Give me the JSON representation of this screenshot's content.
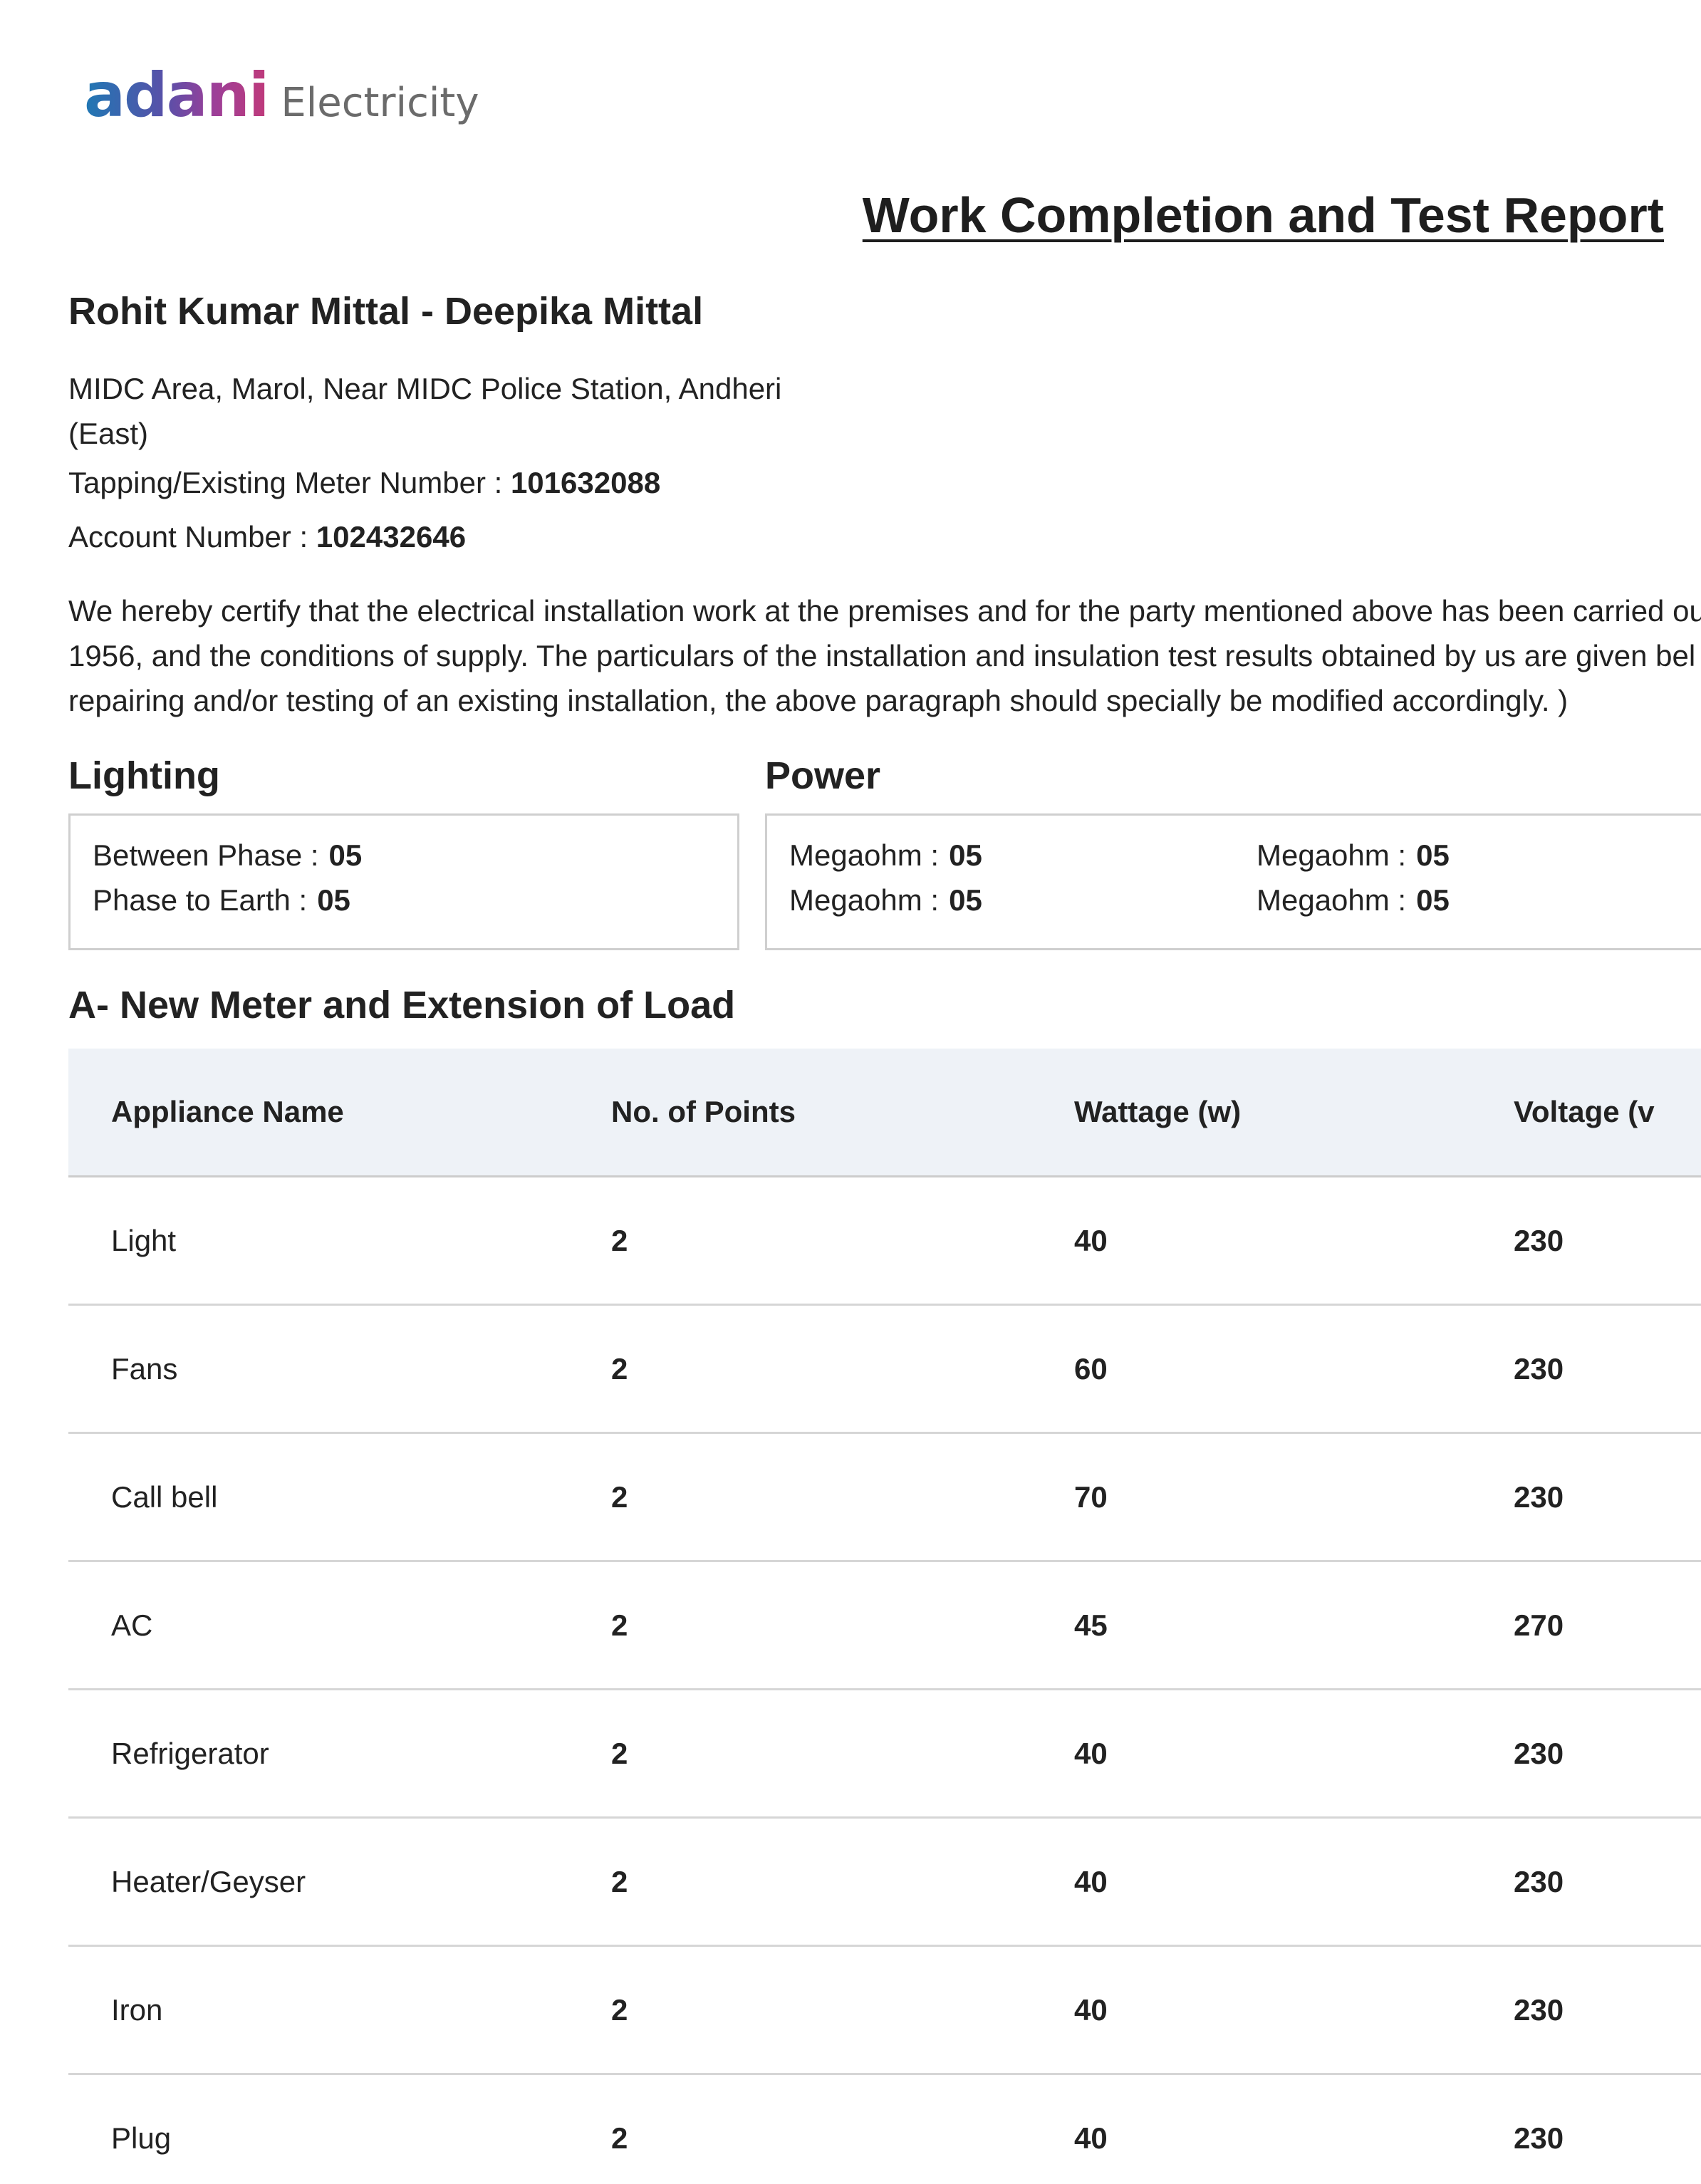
{
  "header": {
    "logo_brand": "adani",
    "logo_sub": "Electricity",
    "title": "Work Completion and Test Report"
  },
  "party": {
    "name": "Rohit Kumar Mittal - Deepika Mittal",
    "address_line1": "MIDC Area, Marol, Near MIDC Police Station, Andheri",
    "address_line2": "(East)",
    "meter_label": "Tapping/Existing Meter Number :",
    "meter_number": "101632088",
    "account_label": "Account Number :",
    "account_number": "102432646"
  },
  "certification": {
    "line1": "We hereby certify that the electrical installation work at the premises and for the party mentioned above has been carried ou",
    "line2": "1956, and the conditions of supply. The particulars of the installation and insulation test results obtained by us are given bel",
    "line3": "repairing and/or testing of an existing installation, the above paragraph should specially be modified accordingly. )"
  },
  "lighting": {
    "heading": "Lighting",
    "between_phase_label": "Between Phase :",
    "between_phase_value": "05",
    "phase_to_earth_label": "Phase to Earth :",
    "phase_to_earth_value": "05"
  },
  "power": {
    "heading": "Power",
    "items": [
      {
        "label": "Megaohm :",
        "value": "05"
      },
      {
        "label": "Megaohm :",
        "value": "05"
      },
      {
        "label": "Megaohm :",
        "value": "05"
      },
      {
        "label": "Megaohm :",
        "value": "05"
      }
    ]
  },
  "new_meter": {
    "heading": "A- New Meter and Extension of Load",
    "columns": [
      "Appliance Name",
      "No. of Points",
      "Wattage (w)",
      "Voltage (v"
    ],
    "rows": [
      {
        "name": "Light",
        "points": "2",
        "wattage": "40",
        "voltage": "230"
      },
      {
        "name": "Fans",
        "points": "2",
        "wattage": "60",
        "voltage": "230"
      },
      {
        "name": "Call bell",
        "points": "2",
        "wattage": "70",
        "voltage": "230"
      },
      {
        "name": "AC",
        "points": "2",
        "wattage": "45",
        "voltage": "270"
      },
      {
        "name": "Refrigerator",
        "points": "2",
        "wattage": "40",
        "voltage": "230"
      },
      {
        "name": "Heater/Geyser",
        "points": "2",
        "wattage": "40",
        "voltage": "230"
      },
      {
        "name": "Iron",
        "points": "2",
        "wattage": "40",
        "voltage": "230"
      },
      {
        "name": "Plug",
        "points": "2",
        "wattage": "40",
        "voltage": "230"
      }
    ]
  }
}
